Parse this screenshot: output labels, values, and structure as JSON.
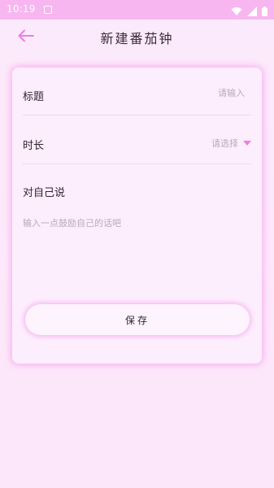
{
  "status_bar": {
    "time": "10:19",
    "icons": [
      "notification-box-icon",
      "wifi-icon",
      "signal-icon",
      "battery-icon"
    ],
    "background": "#f7b6ef"
  },
  "app_bar": {
    "title": "新建番茄钟",
    "back_icon": "arrow-left-icon",
    "accent": "#ee7ee2"
  },
  "form": {
    "title_label": "标题",
    "title_placeholder": "请输入",
    "duration_label": "时长",
    "duration_placeholder": "请选择",
    "self_label": "对自己说",
    "self_placeholder": "输入一点鼓励自己的话吧"
  },
  "actions": {
    "save_label": "保存"
  }
}
